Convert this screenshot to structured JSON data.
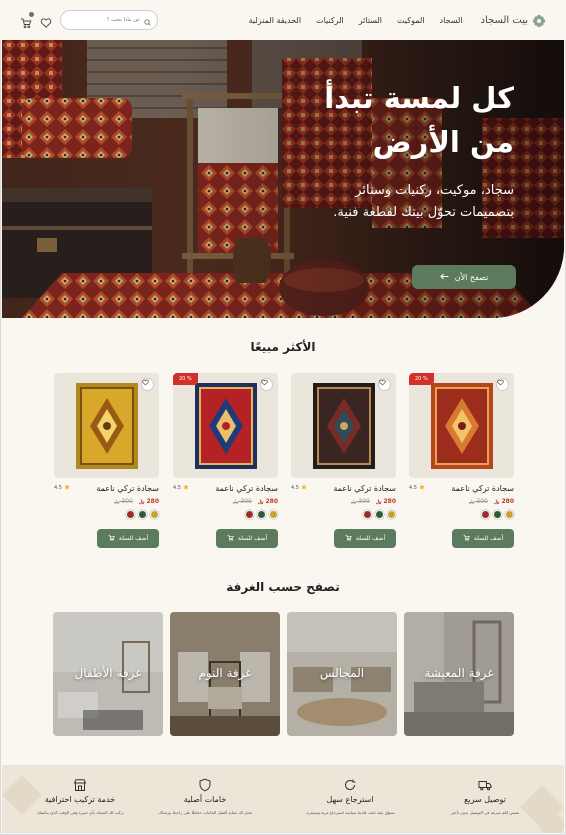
{
  "nav": {
    "brand": "بيت السجاد",
    "menu": [
      "السجاد",
      "الموكيت",
      "الستائر",
      "الركنيات",
      "الحديقة المنزلية"
    ],
    "search_placeholder": "عن ماذا تبحث ؟"
  },
  "hero": {
    "title_line1": "كل لمسة تبدأ",
    "title_line2": "من الأرض",
    "subtitle_line1": "سجاد، موكيت، ركنيات وستائر",
    "subtitle_line2": "بتصميمات تحوّل بيتك لقطعة فنية.",
    "cta": "تصفح الأن"
  },
  "best_sellers": {
    "title": "الأكثر مبيعًا",
    "products": [
      {
        "name": "سجادة تركي ناعمة",
        "rating": "4.5",
        "price_new": "280",
        "price_old": "300",
        "sale": "20 %",
        "has_sale": true,
        "palette": "red-orange",
        "add_label": "أضف للسلة",
        "swatches": [
          "#c9a12a",
          "#2f5b3a",
          "#a12a2a"
        ]
      },
      {
        "name": "سجادة تركي ناعمة",
        "rating": "4.5",
        "price_new": "280",
        "price_old": "300",
        "sale": "",
        "has_sale": false,
        "palette": "dark",
        "add_label": "أضف للسلة",
        "swatches": [
          "#c9a12a",
          "#2f5b3a",
          "#a12a2a"
        ]
      },
      {
        "name": "سجادة تركي ناعمة",
        "rating": "4.5",
        "price_new": "280",
        "price_old": "300",
        "sale": "20 %",
        "has_sale": true,
        "palette": "red-blue",
        "add_label": "أضف للسلة",
        "swatches": [
          "#c9a12a",
          "#2f5b3a",
          "#a12a2a"
        ]
      },
      {
        "name": "سجادة تركي ناعمة",
        "rating": "4.5",
        "price_new": "280",
        "price_old": "300",
        "sale": "",
        "has_sale": false,
        "palette": "gold",
        "add_label": "أضف للسلة",
        "swatches": [
          "#c9a12a",
          "#2f5b3a",
          "#a12a2a"
        ]
      }
    ]
  },
  "rooms": {
    "title": "تصفح حسب الغرفة",
    "items": [
      {
        "label": "غرفة المعيشة",
        "tone": "#b7b1a6"
      },
      {
        "label": "المجالس",
        "tone": "#c9c3b8"
      },
      {
        "label": "غرفة النوم",
        "tone": "#9f927d"
      },
      {
        "label": "غرفة الأطفال",
        "tone": "#d6d1c8"
      }
    ]
  },
  "features": [
    {
      "title": "توصيل سريع",
      "desc": "نضمن لكم سرعة في التوصيل بدون تأخير",
      "icon": "truck-icon"
    },
    {
      "title": "استرجاع سهل",
      "desc": "تسوّق بثقة تامة، فلدينا سياسة استرجاع مرنة وميسرة.",
      "icon": "refresh-icon"
    },
    {
      "title": "خامات أصلية",
      "desc": "نختار لك بعناية أفضل الخامات حفاظًا على راحتك ورضاك.",
      "icon": "shield-icon"
    },
    {
      "title": "خدمة تركيب احترافية",
      "desc": "نركب لك السجاد بأيدٍ خبيرة وفي الوقت الذي يناسبك.",
      "icon": "store-icon"
    }
  ],
  "colors": {
    "accent": "#5b7a5e",
    "sale": "#d1302b",
    "background": "#faf7f0"
  }
}
